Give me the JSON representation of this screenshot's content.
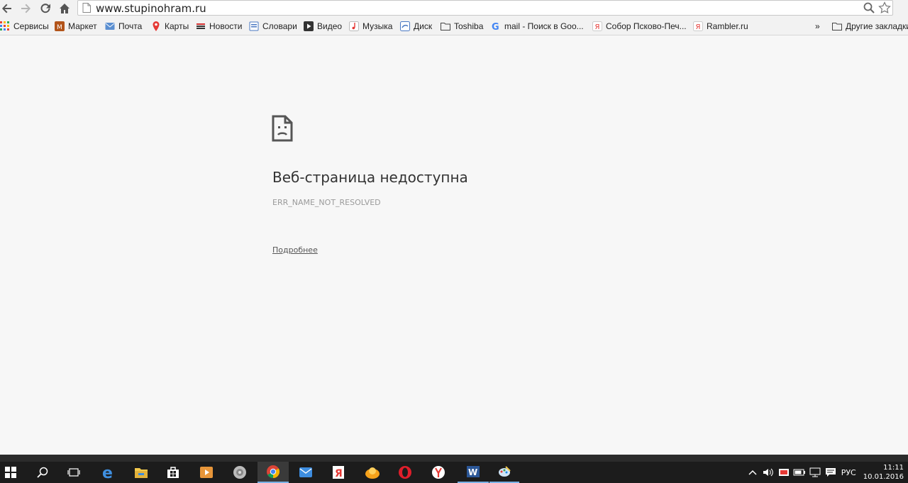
{
  "browser": {
    "url": "www.stupinohram.ru"
  },
  "bookmarks": {
    "apps_label": "Сервисы",
    "items": [
      {
        "label": "Маркет",
        "icon": "market-icon"
      },
      {
        "label": "Почта",
        "icon": "mail-icon"
      },
      {
        "label": "Карты",
        "icon": "map-pin-icon"
      },
      {
        "label": "Новости",
        "icon": "news-icon"
      },
      {
        "label": "Словари",
        "icon": "dictionary-icon"
      },
      {
        "label": "Видео",
        "icon": "video-icon"
      },
      {
        "label": "Музыка",
        "icon": "music-icon"
      },
      {
        "label": "Диск",
        "icon": "disk-icon"
      },
      {
        "label": "Toshiba",
        "icon": "folder-icon"
      },
      {
        "label": "mail - Поиск в Goo...",
        "icon": "google-icon"
      },
      {
        "label": "Собор Псково-Печ...",
        "icon": "yandex-icon"
      },
      {
        "label": "Rambler.ru",
        "icon": "yandex-icon"
      }
    ],
    "overflow": "»",
    "other_label": "Другие закладки"
  },
  "error": {
    "title": "Веб-страница недоступна",
    "code": "ERR_NAME_NOT_RESOLVED",
    "details_link": "Подробнее"
  },
  "taskbar": {
    "lang": "РУС",
    "time": "11:11",
    "date": "10.01.2016"
  },
  "colors": {
    "page_bg": "#f7f7f7",
    "taskbar_bg": "#1c1c1c",
    "accent": "#7ab2e6"
  }
}
